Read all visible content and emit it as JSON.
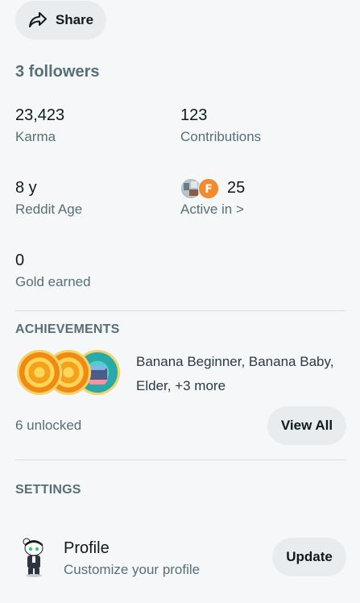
{
  "share": {
    "label": "Share",
    "icon": "share-icon"
  },
  "followers": "3 followers",
  "stats": {
    "karma": {
      "value": "23,423",
      "label": "Karma"
    },
    "contributions": {
      "value": "123",
      "label": "Contributions"
    },
    "reddit_age": {
      "value": "8 y",
      "label": "Reddit Age"
    },
    "active_in": {
      "value": "25",
      "label": "Active in >"
    },
    "gold": {
      "value": "0",
      "label": "Gold earned"
    }
  },
  "achievements": {
    "heading": "ACHIEVEMENTS",
    "summary": "Banana Beginner, Banana Baby, Elder, +3 more",
    "unlocked": "6 unlocked",
    "view_all": "View All"
  },
  "settings": {
    "heading": "SETTINGS",
    "profile": {
      "title": "Profile",
      "subtitle": "Customize your profile",
      "button": "Update"
    }
  },
  "colors": {
    "background": "#f6f7f8",
    "button_bg": "#e9ecef",
    "secondary_text": "#576f76"
  }
}
